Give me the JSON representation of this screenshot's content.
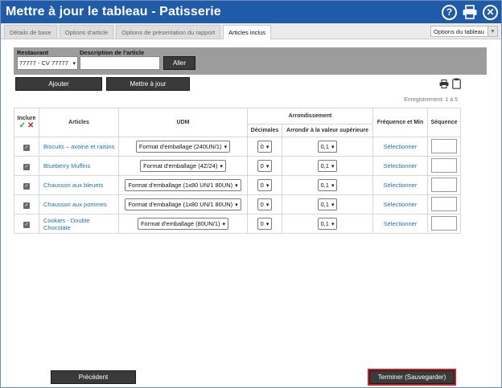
{
  "window": {
    "title": "Mettre à jour le tableau - Patisserie"
  },
  "tabs": [
    {
      "label": "Détails de base",
      "active": false
    },
    {
      "label": "Options d'article",
      "active": false
    },
    {
      "label": "Options de présentation du rapport",
      "active": false
    },
    {
      "label": "Articles inclus",
      "active": true
    }
  ],
  "table_options": {
    "label": "Options du tableau"
  },
  "filter": {
    "restaurant_label": "Restaurant",
    "restaurant_value": "77777 - CV 77777",
    "description_label": "Description de l'article",
    "description_value": "",
    "go_label": "Aller"
  },
  "actions": {
    "add_label": "Ajouter",
    "update_label": "Mettre à jour"
  },
  "record_count": "Enregistrement: 1 à 5",
  "columns": {
    "include": "Inclure",
    "articles": "Articles",
    "udm": "UDM",
    "rounding": "Arrondissement",
    "decimals": "Décimales",
    "round_up": "Arrondir à la valeur supérieure",
    "frequency": "Fréquence et Min",
    "sequence": "Séquence"
  },
  "rows": [
    {
      "included": true,
      "article": "Biscuits – avoine et raisins",
      "udm": "Format d'emballage (240UN/1)",
      "decimals": "0",
      "round_up": "0,1",
      "frequency": "Sélectionner",
      "sequence": ""
    },
    {
      "included": true,
      "article": "Blueberry Muffins",
      "udm": "Format d'emballage (4Z/24)",
      "decimals": "0",
      "round_up": "0,1",
      "frequency": "Sélectionner",
      "sequence": ""
    },
    {
      "included": true,
      "article": "Chausson aux bleuets",
      "udm": "Format d'emballage (1x80 UN/1 80UN)",
      "decimals": "0",
      "round_up": "0,1",
      "frequency": "Sélectionner",
      "sequence": ""
    },
    {
      "included": true,
      "article": "Chausson aux pommes",
      "udm": "Format d'emballage (1x80 UN/1 80UN)",
      "decimals": "0",
      "round_up": "0,1",
      "frequency": "Sélectionner",
      "sequence": ""
    },
    {
      "included": true,
      "article": "Cookies - Double Chocolate",
      "udm": "Format d'emballage (80UN/1)",
      "decimals": "0",
      "round_up": "0,1",
      "frequency": "Sélectionner",
      "sequence": ""
    }
  ],
  "footer": {
    "previous_label": "Précédent",
    "finish_label": "Terminer (Sauvegarder)"
  },
  "icons": {
    "help": "help-icon",
    "print": "print-icon",
    "close": "close-icon",
    "clipboard": "clipboard-icon"
  },
  "colors": {
    "titlebar": "#1f5ba8",
    "link": "#1f6fb0",
    "finish_outline": "#d41d1d",
    "filter_bg": "#9c9c9c"
  }
}
